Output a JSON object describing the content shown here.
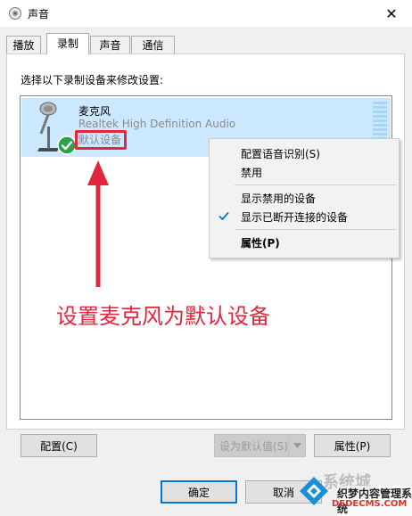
{
  "window": {
    "title": "声音",
    "close_glyph": "✕"
  },
  "tabs": [
    {
      "label": "播放"
    },
    {
      "label": "录制"
    },
    {
      "label": "声音"
    },
    {
      "label": "通信"
    }
  ],
  "active_tab": "录制",
  "instruction": "选择以下录制设备来修改设置:",
  "device": {
    "name": "麦克风",
    "description": "Realtek High Definition Audio",
    "status": "默认设备",
    "icon": "microphone-icon",
    "status_icon": "green-check-icon"
  },
  "context_menu": {
    "items": [
      {
        "label": "配置语音识别(S)"
      },
      {
        "label": "禁用"
      },
      {
        "label": "显示禁用的设备"
      },
      {
        "label": "显示已断开连接的设备",
        "checked": true
      },
      {
        "label": "属性(P)"
      }
    ]
  },
  "annotation": {
    "text": "设置麦克风为默认设备",
    "color": "#e2263c"
  },
  "buttons": {
    "configure": "配置(C)",
    "set_default": "设为默认值(S)",
    "properties": "属性(P)",
    "ok": "确定",
    "cancel": "取消"
  },
  "watermark": {
    "top_text": "系统城",
    "mid_text": "织梦内容管理系统",
    "bottom_text": "DEDECMS.COM"
  },
  "colors": {
    "selection": "#cce8ff",
    "accent": "#0078d7",
    "annotation_red": "#e2263c"
  }
}
